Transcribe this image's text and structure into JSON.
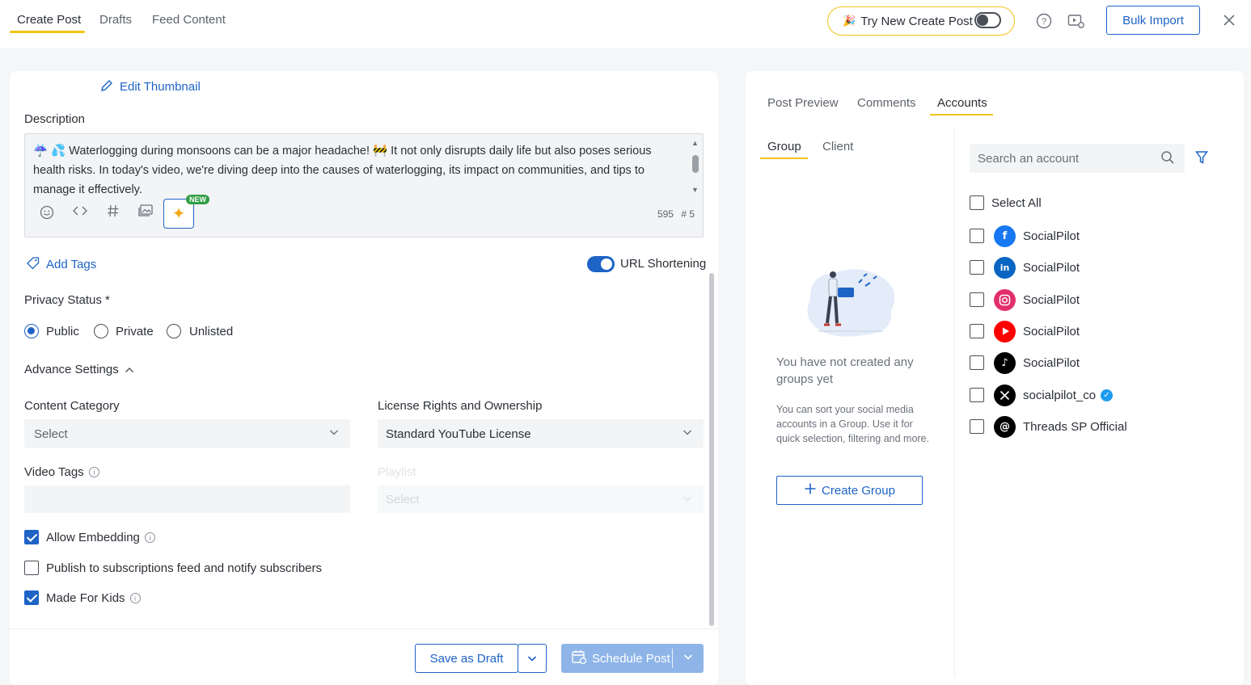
{
  "top_tabs": [
    "Create Post",
    "Drafts",
    "Feed Content"
  ],
  "try_new": {
    "label": "Try New Create Post",
    "enabled": false
  },
  "bulk_import": "Bulk Import",
  "left": {
    "edit_thumbnail": "Edit Thumbnail",
    "description_label": "Description",
    "description_text": "☔ 💦 Waterlogging during monsoons can be a major headache! 🚧 It not only disrupts daily life but also poses serious health risks. In today's video, we're diving deep into the causes of waterlogging, its impact on communities, and tips to manage it effectively.",
    "new_badge": "NEW",
    "char_count": "595",
    "hashtag_count": "# 5",
    "add_tags": "Add Tags",
    "url_shortening": "URL Shortening",
    "privacy_label": "Privacy Status *",
    "privacy_options": [
      "Public",
      "Private",
      "Unlisted"
    ],
    "privacy_selected": "Public",
    "advance_settings": "Advance Settings",
    "content_category_label": "Content Category",
    "content_category_value": "Select",
    "license_label": "License Rights and Ownership",
    "license_value": "Standard YouTube License",
    "video_tags_label": "Video Tags",
    "playlist_label": "Playlist",
    "playlist_value": "Select",
    "checkboxes": [
      {
        "label": "Allow Embedding",
        "checked": true,
        "info": true
      },
      {
        "label": "Publish to subscriptions feed and notify subscribers",
        "checked": false,
        "info": false
      },
      {
        "label": "Made For Kids",
        "checked": true,
        "info": true
      }
    ],
    "save_draft": "Save as Draft",
    "schedule_post": "Schedule Post"
  },
  "right": {
    "tabs": [
      "Post Preview",
      "Comments",
      "Accounts"
    ],
    "active_tab": "Accounts",
    "sub_tabs": [
      "Group",
      "Client"
    ],
    "empty_title": "You have not created any groups yet",
    "empty_desc": "You can sort your social media accounts in a Group. Use it for quick selection, filtering and more.",
    "create_group": "Create Group",
    "search_placeholder": "Search an account",
    "select_all": "Select All",
    "accounts": [
      {
        "name": "SocialPilot",
        "network": "facebook",
        "color": "#1877f2"
      },
      {
        "name": "SocialPilot",
        "network": "linkedin",
        "color": "#0a66c2"
      },
      {
        "name": "SocialPilot",
        "network": "instagram",
        "color": "#e1306c"
      },
      {
        "name": "SocialPilot",
        "network": "youtube",
        "color": "#ff0000"
      },
      {
        "name": "SocialPilot",
        "network": "tiktok",
        "color": "#000000"
      },
      {
        "name": "socialpilot_co",
        "network": "x",
        "color": "#000000",
        "verified": true
      },
      {
        "name": "Threads SP Official",
        "network": "threads",
        "color": "#000000"
      }
    ]
  }
}
